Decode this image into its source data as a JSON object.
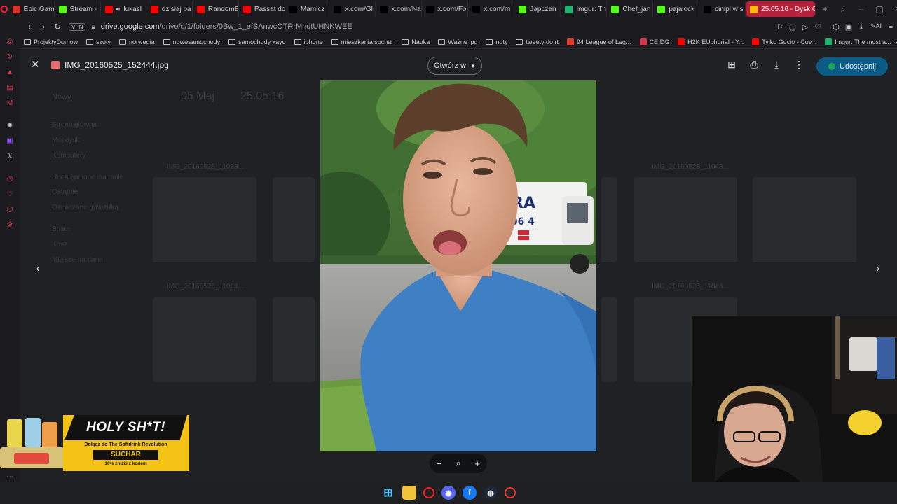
{
  "tabs": [
    {
      "label": "Epic Gam",
      "icon": "gmail-icon",
      "color": "#d93025"
    },
    {
      "label": "Stream -",
      "icon": "kick-icon",
      "color": "#53fc18"
    },
    {
      "label": "lukasl",
      "icon": "youtube-icon",
      "color": "#ff0000",
      "playing": true
    },
    {
      "label": "dzisiaj ba",
      "icon": "youtube-icon",
      "color": "#ff0000"
    },
    {
      "label": "RandomE",
      "icon": "youtube-icon",
      "color": "#ff0000"
    },
    {
      "label": "Passat dc",
      "icon": "youtube-icon",
      "color": "#ff0000"
    },
    {
      "label": "Mamicz",
      "icon": "x-icon",
      "color": "#000000"
    },
    {
      "label": "x.com/Gl",
      "icon": "x-icon",
      "color": "#000000"
    },
    {
      "label": "x.com/Na",
      "icon": "x-icon",
      "color": "#000000"
    },
    {
      "label": "x.com/Fo",
      "icon": "x-icon",
      "color": "#000000"
    },
    {
      "label": "x.com/m",
      "icon": "x-icon",
      "color": "#000000"
    },
    {
      "label": "Japczan",
      "icon": "kick-icon",
      "color": "#53fc18"
    },
    {
      "label": "Imgur: Th",
      "icon": "imgur-icon",
      "color": "#1bb76e"
    },
    {
      "label": "Chef_jan",
      "icon": "kick-icon",
      "color": "#53fc18"
    },
    {
      "label": "pajalock",
      "icon": "kick-icon",
      "color": "#53fc18"
    },
    {
      "label": "cinipl w s",
      "icon": "x-icon",
      "color": "#000000"
    },
    {
      "label": "25.05.16 - Dysk G",
      "icon": "drive-icon",
      "color": "#fbbc04",
      "active": true
    }
  ],
  "address": {
    "vpn": "VPN",
    "url_host": "drive.google.com",
    "url_path": "/drive/u/1/folders/0Bw_1_efSAnwcOTRrMndtUHNKWEE"
  },
  "bookmarks": [
    {
      "label": "ProjektyDomow",
      "type": "folder"
    },
    {
      "label": "szoty",
      "type": "folder"
    },
    {
      "label": "norwegia",
      "type": "folder"
    },
    {
      "label": "nowesamochody",
      "type": "folder"
    },
    {
      "label": "samochody xayo",
      "type": "folder"
    },
    {
      "label": "iphone",
      "type": "folder"
    },
    {
      "label": "mieszkania suchar",
      "type": "folder"
    },
    {
      "label": "Nauka",
      "type": "folder"
    },
    {
      "label": "Ważne jpg",
      "type": "folder"
    },
    {
      "label": "nuty",
      "type": "folder"
    },
    {
      "label": "tweety do rt",
      "type": "folder"
    },
    {
      "label": "94 League of Leg...",
      "type": "site",
      "color": "#e33b2e"
    },
    {
      "label": "CEIDG",
      "type": "site",
      "color": "#d6374a"
    },
    {
      "label": "H2K EUphoria! - Y...",
      "type": "site",
      "color": "#ff0000"
    },
    {
      "label": "Tylko Gucio - Cov...",
      "type": "site",
      "color": "#ff0000"
    },
    {
      "label": "Imgur: The most a...",
      "type": "site",
      "color": "#1bb76e"
    }
  ],
  "viewer": {
    "file_name": "IMG_20160525_152444.jpg",
    "open_with": "Otwórz w",
    "share": "Udostępnij",
    "background_labels": [
      "Nowy",
      "05 Maj",
      "25.05.16",
      "Strona główna",
      "Mój dysk",
      "Komputery",
      "Udostępnione dla mnie",
      "Ostatnie",
      "Oznaczone gwiazdką",
      "Spam",
      "Kosz",
      "Miejsce na dane",
      "IMG_20160525_11033...",
      "IMG_20160525_11043...",
      "IMG_20160525_11044...",
      "IMG_20160525_11044..."
    ]
  },
  "ad": {
    "title": "HOLY SH*T!",
    "subtitle": "Dołącz do The Softdrink Revolution",
    "brand": "SUCHAR",
    "discount": "10% zniżki z kodem"
  },
  "colors": {
    "accent": "#b3213b",
    "share_bg": "#0b5b87",
    "ad_yellow": "#f4c316"
  }
}
